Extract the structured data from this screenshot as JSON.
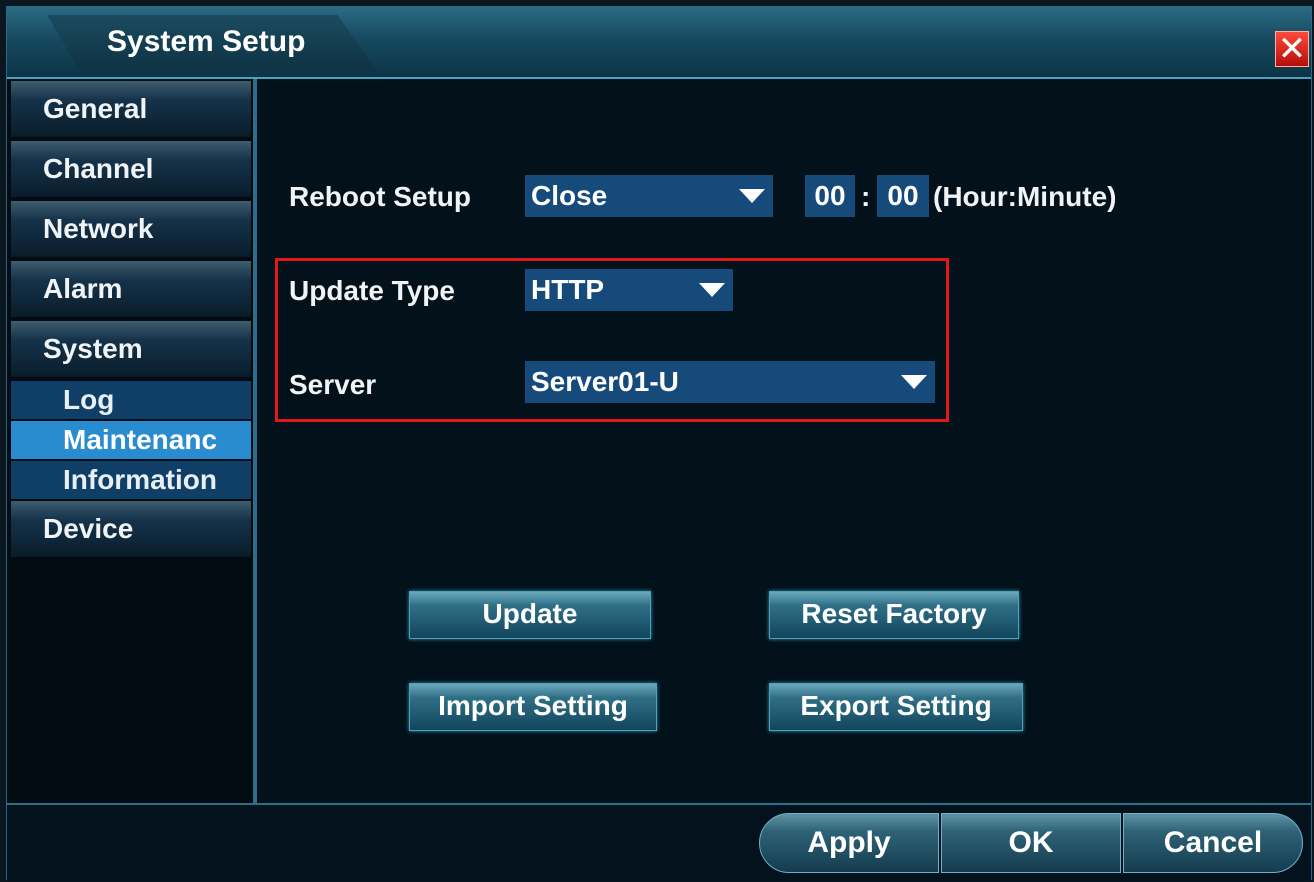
{
  "window": {
    "title": "System Setup",
    "close_glyph": "✕"
  },
  "sidebar": {
    "items": [
      {
        "label": "General"
      },
      {
        "label": "Channel"
      },
      {
        "label": "Network"
      },
      {
        "label": "Alarm"
      },
      {
        "label": "System"
      }
    ],
    "sub_items": [
      {
        "label": "Log"
      },
      {
        "label": "Maintenanc",
        "active": true
      },
      {
        "label": "Information"
      }
    ],
    "after": [
      {
        "label": "Device"
      }
    ]
  },
  "form": {
    "reboot_label": "Reboot Setup",
    "reboot_value": "Close",
    "hour": "00",
    "separator": ":",
    "minute": "00",
    "time_unit": "(Hour:Minute)",
    "update_type_label": "Update Type",
    "update_type_value": "HTTP",
    "server_label": "Server",
    "server_value": "Server01-U"
  },
  "actions": {
    "update": "Update",
    "reset_factory": "Reset Factory",
    "import_setting": "Import Setting",
    "export_setting": "Export Setting"
  },
  "footer": {
    "apply": "Apply",
    "ok": "OK",
    "cancel": "Cancel"
  },
  "colors": {
    "highlight_border": "#e01818",
    "accent": "#2a8cd0"
  }
}
